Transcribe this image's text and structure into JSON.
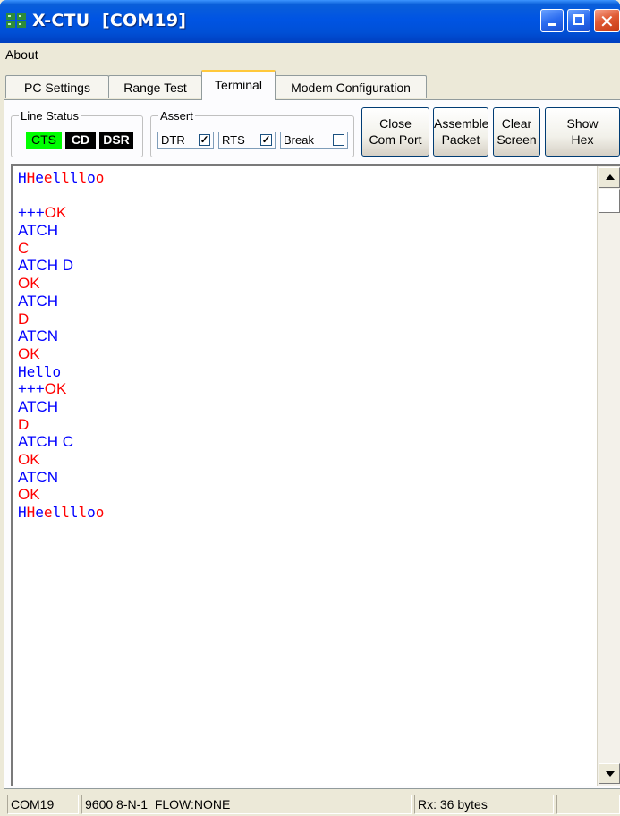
{
  "window": {
    "title": "X-CTU  [COM19]",
    "icon": "xctu-app-icon",
    "controls": [
      "minimize-icon",
      "maximize-icon",
      "close-icon"
    ]
  },
  "menu": {
    "items": [
      "About"
    ]
  },
  "tabs": {
    "items": [
      "PC Settings",
      "Range Test",
      "Terminal",
      "Modem Configuration"
    ],
    "active": "Terminal"
  },
  "line_status": {
    "legend": "Line Status",
    "indicators": [
      "CTS",
      "CD",
      "DSR"
    ],
    "colors": {
      "cts_active": "#00ff00",
      "inactive": "#000000"
    }
  },
  "assert": {
    "legend": "Assert",
    "dtr": {
      "label": "DTR",
      "checked": true
    },
    "rts": {
      "label": "RTS",
      "checked": true
    },
    "break": {
      "label": "Break",
      "checked": false
    }
  },
  "buttons": {
    "close_port": [
      "Close",
      "Com Port"
    ],
    "assemble": [
      "Assemble",
      "Packet"
    ],
    "clear": [
      "Clear",
      "Screen"
    ],
    "show_hex": [
      "Show",
      "Hex"
    ]
  },
  "terminal": {
    "colors": {
      "sent": "#0000ff",
      "received": "#ff0000"
    },
    "lines": [
      [
        {
          "t": "H",
          "c": "s"
        },
        {
          "t": "H",
          "c": "r"
        },
        {
          "t": "e",
          "c": "s"
        },
        {
          "t": "e",
          "c": "r"
        },
        {
          "t": "l",
          "c": "s"
        },
        {
          "t": "l",
          "c": "r"
        },
        {
          "t": "l",
          "c": "s"
        },
        {
          "t": "l",
          "c": "r"
        },
        {
          "t": "o",
          "c": "s"
        },
        {
          "t": "o",
          "c": "r"
        }
      ],
      [],
      [
        {
          "t": "+++",
          "c": "s"
        },
        {
          "t": "OK",
          "c": "r"
        }
      ],
      [
        {
          "t": "ATCH",
          "c": "s"
        }
      ],
      [
        {
          "t": "C",
          "c": "r"
        }
      ],
      [
        {
          "t": "ATCH D",
          "c": "s"
        }
      ],
      [
        {
          "t": "OK",
          "c": "r"
        }
      ],
      [
        {
          "t": "ATCH",
          "c": "s"
        }
      ],
      [
        {
          "t": "D",
          "c": "r"
        }
      ],
      [
        {
          "t": "ATCN",
          "c": "s"
        }
      ],
      [
        {
          "t": "OK",
          "c": "r"
        }
      ],
      [
        {
          "t": "Hello",
          "c": "s"
        }
      ],
      [
        {
          "t": "+++",
          "c": "s"
        },
        {
          "t": "OK",
          "c": "r"
        }
      ],
      [
        {
          "t": "ATCH",
          "c": "s"
        }
      ],
      [
        {
          "t": "D",
          "c": "r"
        }
      ],
      [
        {
          "t": "ATCH C",
          "c": "s"
        }
      ],
      [
        {
          "t": "OK",
          "c": "r"
        }
      ],
      [
        {
          "t": "ATCN",
          "c": "s"
        }
      ],
      [
        {
          "t": "OK",
          "c": "r"
        }
      ],
      [
        {
          "t": "H",
          "c": "s"
        },
        {
          "t": "H",
          "c": "r"
        },
        {
          "t": "e",
          "c": "s"
        },
        {
          "t": "e",
          "c": "r"
        },
        {
          "t": "l",
          "c": "s"
        },
        {
          "t": "l",
          "c": "r"
        },
        {
          "t": "l",
          "c": "s"
        },
        {
          "t": "l",
          "c": "r"
        },
        {
          "t": "o",
          "c": "s"
        },
        {
          "t": "o",
          "c": "r"
        }
      ]
    ]
  },
  "statusbar": {
    "port": "COM19",
    "config": "9600 8-N-1  FLOW:NONE",
    "rx": "Rx: 36 bytes",
    "blank": ""
  }
}
